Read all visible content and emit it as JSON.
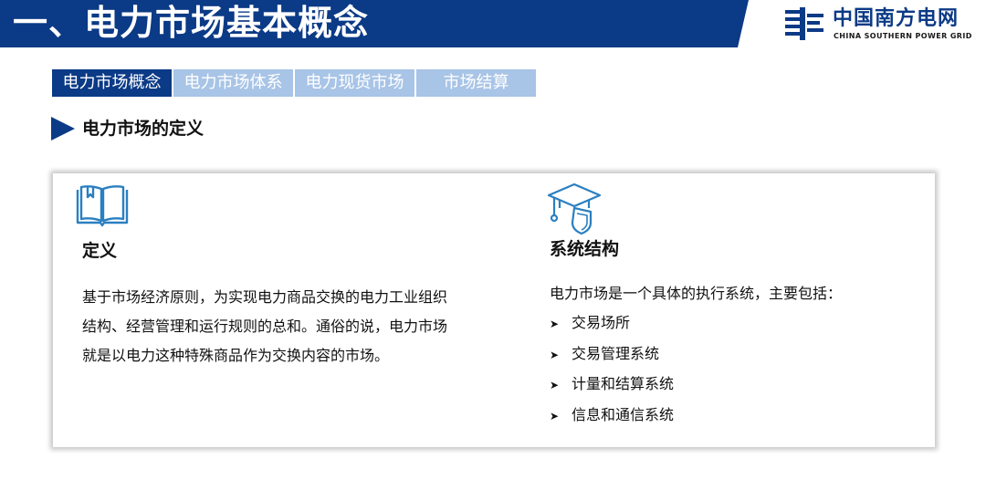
{
  "header": {
    "title": "一、电力市场基本概念",
    "color": "#0b3a86"
  },
  "logo": {
    "name_cn": "中国南方电网",
    "name_en": "CHINA SOUTHERN POWER GRID",
    "icon": "power-grid-logo-icon"
  },
  "tabs": [
    {
      "label": "电力市场概念",
      "active": true
    },
    {
      "label": "电力市场体系",
      "active": false
    },
    {
      "label": "电力现货市场",
      "active": false
    },
    {
      "label": "市场结算",
      "active": false
    }
  ],
  "section": {
    "title": "电力市场的定义",
    "icon": "triangle-right-icon"
  },
  "card": {
    "definition": {
      "icon": "book-icon",
      "heading": "定义",
      "text": "基于市场经济原则，为实现电力商品交换的电力工业组织结构、经营管理和运行规则的总和。通俗的说，电力市场就是以电力这种特殊商品作为交换内容的市场。"
    },
    "system": {
      "icon": "graduation-cap-shield-icon",
      "heading": "系统结构",
      "intro": "电力市场是一个具体的执行系统，主要包括：",
      "bullet_icon": "arrow-bullet-icon",
      "items": [
        "交易场所",
        "交易管理系统",
        "计量和结算系统",
        "信息和通信系统"
      ]
    }
  },
  "colors": {
    "primary": "#0b3a86",
    "tab_inactive": "#a8c4e6",
    "icon_blue": "#2a7fc1"
  }
}
